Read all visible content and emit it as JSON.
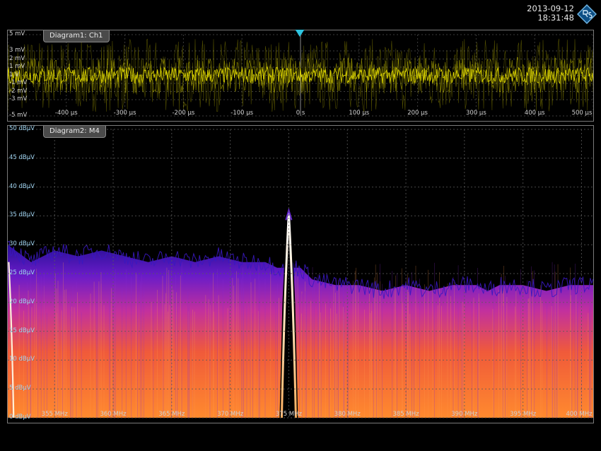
{
  "header": {
    "date": "2013-09-12",
    "time": "18:31:48",
    "logo_icon": "rohde-schwarz-logo"
  },
  "chart_data": [
    {
      "type": "line",
      "panel_label": "Diagram1: Ch1",
      "trace_color": "#e8e000",
      "x_unit": "µs",
      "y_unit": "mV",
      "xlim": [
        -500,
        500
      ],
      "ylim": [
        -5,
        5
      ],
      "x_ticks": [
        "-400 µs",
        "-300 µs",
        "-200 µs",
        "-100 µs",
        "0 s",
        "100 µs",
        "200 µs",
        "300 µs",
        "400 µs",
        "500 µs"
      ],
      "x_tick_values": [
        -400,
        -300,
        -200,
        -100,
        0,
        100,
        200,
        300,
        400,
        500
      ],
      "y_ticks": [
        "5 mV",
        "3 mV",
        "2 mV",
        "1 mV",
        "1 V",
        "-1 mV",
        "-2 mV",
        "-3 mV",
        "-5 mV"
      ],
      "y_tick_values": [
        5,
        3,
        2,
        1,
        0,
        -1,
        -2,
        -3,
        -5
      ],
      "signal": {
        "description": "noise",
        "dense_band_mV": [
          -1,
          1
        ],
        "peak_band_mV": [
          -4.5,
          4.5
        ]
      },
      "trigger_marker_x": 0,
      "grid": true
    },
    {
      "type": "area",
      "panel_label": "Diagram2: M4",
      "x_unit": "MHz",
      "y_unit": "dBµV",
      "xlim": [
        351,
        401
      ],
      "ylim": [
        0,
        50
      ],
      "x_ticks": [
        "355 MHz",
        "360 MHz",
        "365 MHz",
        "370 MHz",
        "375 MHz",
        "380 MHz",
        "385 MHz",
        "390 MHz",
        "395 MHz",
        "400 MHz"
      ],
      "x_tick_values": [
        355,
        360,
        365,
        370,
        375,
        380,
        385,
        390,
        395,
        400
      ],
      "y_ticks": [
        "50 dBµV",
        "45 dBµV",
        "40 dBµV",
        "35 dBµV",
        "30 dBµV",
        "25 dBµV",
        "20 dBµV",
        "15 dBµV",
        "10 dBµV",
        "5 dBµV",
        "0 dBµV"
      ],
      "y_tick_values": [
        50,
        45,
        40,
        35,
        30,
        25,
        20,
        15,
        10,
        5,
        0
      ],
      "series": [
        {
          "x": [
            351,
            353,
            355,
            357,
            359,
            361,
            363,
            365,
            367,
            369,
            371,
            373,
            374,
            376,
            377,
            379,
            381,
            383,
            385,
            387,
            389,
            390,
            391,
            392,
            393,
            395,
            397,
            399,
            401
          ],
          "values": [
            30,
            27,
            29,
            28,
            29,
            28,
            27,
            28,
            27,
            28,
            27,
            27,
            26,
            26,
            24,
            23,
            23,
            22,
            23,
            22,
            23,
            23,
            23,
            22,
            23,
            23,
            22,
            23,
            23
          ]
        }
      ],
      "peaks": [
        {
          "x": 375,
          "y": 35.5
        },
        {
          "x": 351.2,
          "y": 27
        }
      ],
      "grid": true
    }
  ]
}
